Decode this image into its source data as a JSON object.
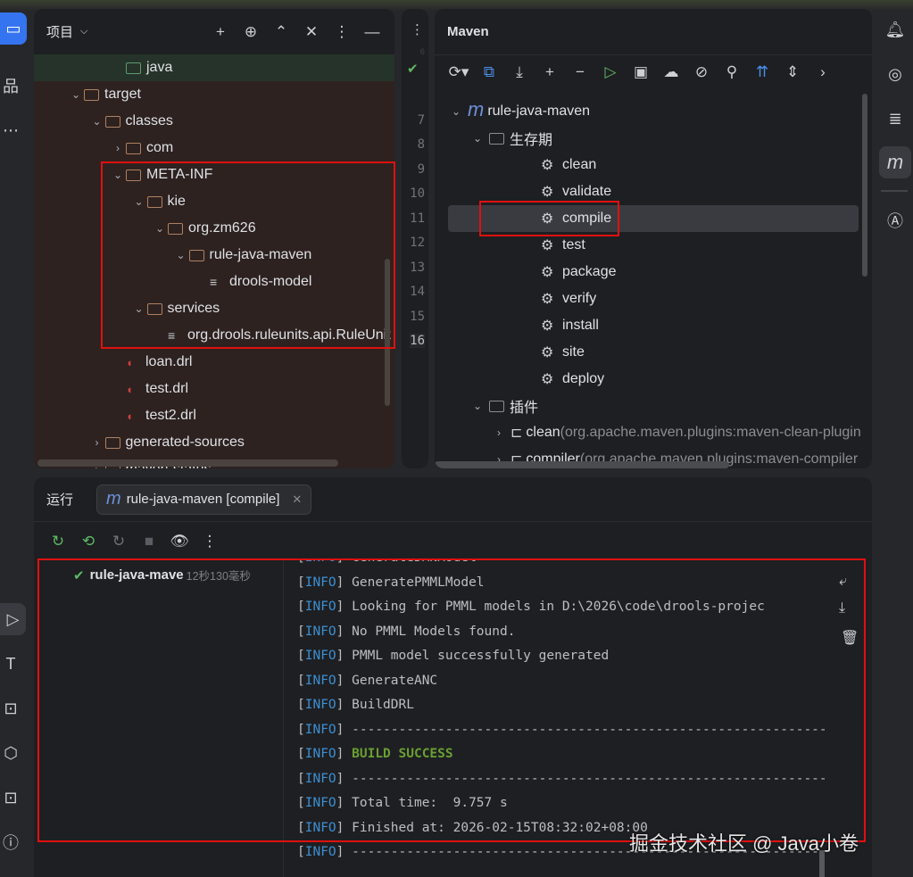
{
  "project": {
    "title": "项目",
    "tree": [
      {
        "label": "java",
        "level": 2,
        "type": "folder-green",
        "chev": ""
      },
      {
        "label": "target",
        "level": 0,
        "type": "folder",
        "chev": "open"
      },
      {
        "label": "classes",
        "level": 1,
        "type": "folder",
        "chev": "open"
      },
      {
        "label": "com",
        "level": 2,
        "type": "folder",
        "chev": "closed"
      },
      {
        "label": "META-INF",
        "level": 2,
        "type": "folder",
        "chev": "open"
      },
      {
        "label": "kie",
        "level": 3,
        "type": "folder",
        "chev": "open"
      },
      {
        "label": "org.zm626",
        "level": 4,
        "type": "folder",
        "chev": "open"
      },
      {
        "label": "rule-java-maven",
        "level": 5,
        "type": "folder",
        "chev": "open"
      },
      {
        "label": "drools-model",
        "level": 6,
        "type": "file",
        "chev": ""
      },
      {
        "label": "services",
        "level": 3,
        "type": "folder",
        "chev": "open"
      },
      {
        "label": "org.drools.ruleunits.api.RuleUnit",
        "level": 4,
        "type": "file",
        "chev": ""
      },
      {
        "label": "loan.drl",
        "level": 2,
        "type": "drl",
        "chev": ""
      },
      {
        "label": "test.drl",
        "level": 2,
        "type": "drl",
        "chev": ""
      },
      {
        "label": "test2.drl",
        "level": 2,
        "type": "drl",
        "chev": ""
      },
      {
        "label": "generated-sources",
        "level": 1,
        "type": "folder",
        "chev": "closed"
      },
      {
        "label": "maven-status",
        "level": 1,
        "type": "folder",
        "chev": "closed"
      }
    ]
  },
  "gutter": {
    "lines": [
      "6",
      "7",
      "8",
      "9",
      "10",
      "11",
      "12",
      "13",
      "14",
      "15",
      "16"
    ]
  },
  "maven": {
    "title": "Maven",
    "tree": [
      {
        "label": "rule-java-maven",
        "level": 0,
        "type": "m",
        "chev": "open"
      },
      {
        "label": "生存期",
        "level": 1,
        "type": "lifecycle",
        "chev": "open"
      },
      {
        "label": "clean",
        "level": 2,
        "type": "gear"
      },
      {
        "label": "validate",
        "level": 2,
        "type": "gear"
      },
      {
        "label": "compile",
        "level": 2,
        "type": "gear",
        "selected": true
      },
      {
        "label": "test",
        "level": 2,
        "type": "gear"
      },
      {
        "label": "package",
        "level": 2,
        "type": "gear"
      },
      {
        "label": "verify",
        "level": 2,
        "type": "gear"
      },
      {
        "label": "install",
        "level": 2,
        "type": "gear"
      },
      {
        "label": "site",
        "level": 2,
        "type": "gear"
      },
      {
        "label": "deploy",
        "level": 2,
        "type": "gear"
      },
      {
        "label": "插件",
        "level": 1,
        "type": "lifecycle",
        "chev": "open"
      },
      {
        "label": "clean",
        "detail": " (org.apache.maven.plugins:maven-clean-plugin",
        "level": 2,
        "type": "plugin",
        "chev": "closed"
      },
      {
        "label": "compiler",
        "detail": " (org.apache.maven.plugins:maven-compiler",
        "level": 2,
        "type": "plugin",
        "chev": "closed"
      }
    ]
  },
  "run": {
    "title": "运行",
    "tab": "rule-java-maven [compile]",
    "node": "rule-java-mave",
    "time": "12秒130毫秒",
    "tag": "INFO",
    "lines": [
      {
        "text": "GenerateDMNModel"
      },
      {
        "text": "GeneratePMMLModel"
      },
      {
        "text": "Looking for PMML models in D:\\2026\\code\\drools-projec"
      },
      {
        "text": "No PMML Models found."
      },
      {
        "text": "PMML model successfully generated"
      },
      {
        "text": "GenerateANC"
      },
      {
        "text": "BuildDRL"
      },
      {
        "text": "------------------------------------------------------------------------"
      },
      {
        "text": "BUILD SUCCESS",
        "ok": true
      },
      {
        "text": "------------------------------------------------------------------------"
      },
      {
        "text": "Total time:  9.757 s"
      },
      {
        "text": "Finished at: 2026-02-15T08:32:02+08:00"
      },
      {
        "text": "------------------------------------------------------------------------"
      }
    ]
  },
  "watermark": "掘金技术社区 @ Java小卷"
}
